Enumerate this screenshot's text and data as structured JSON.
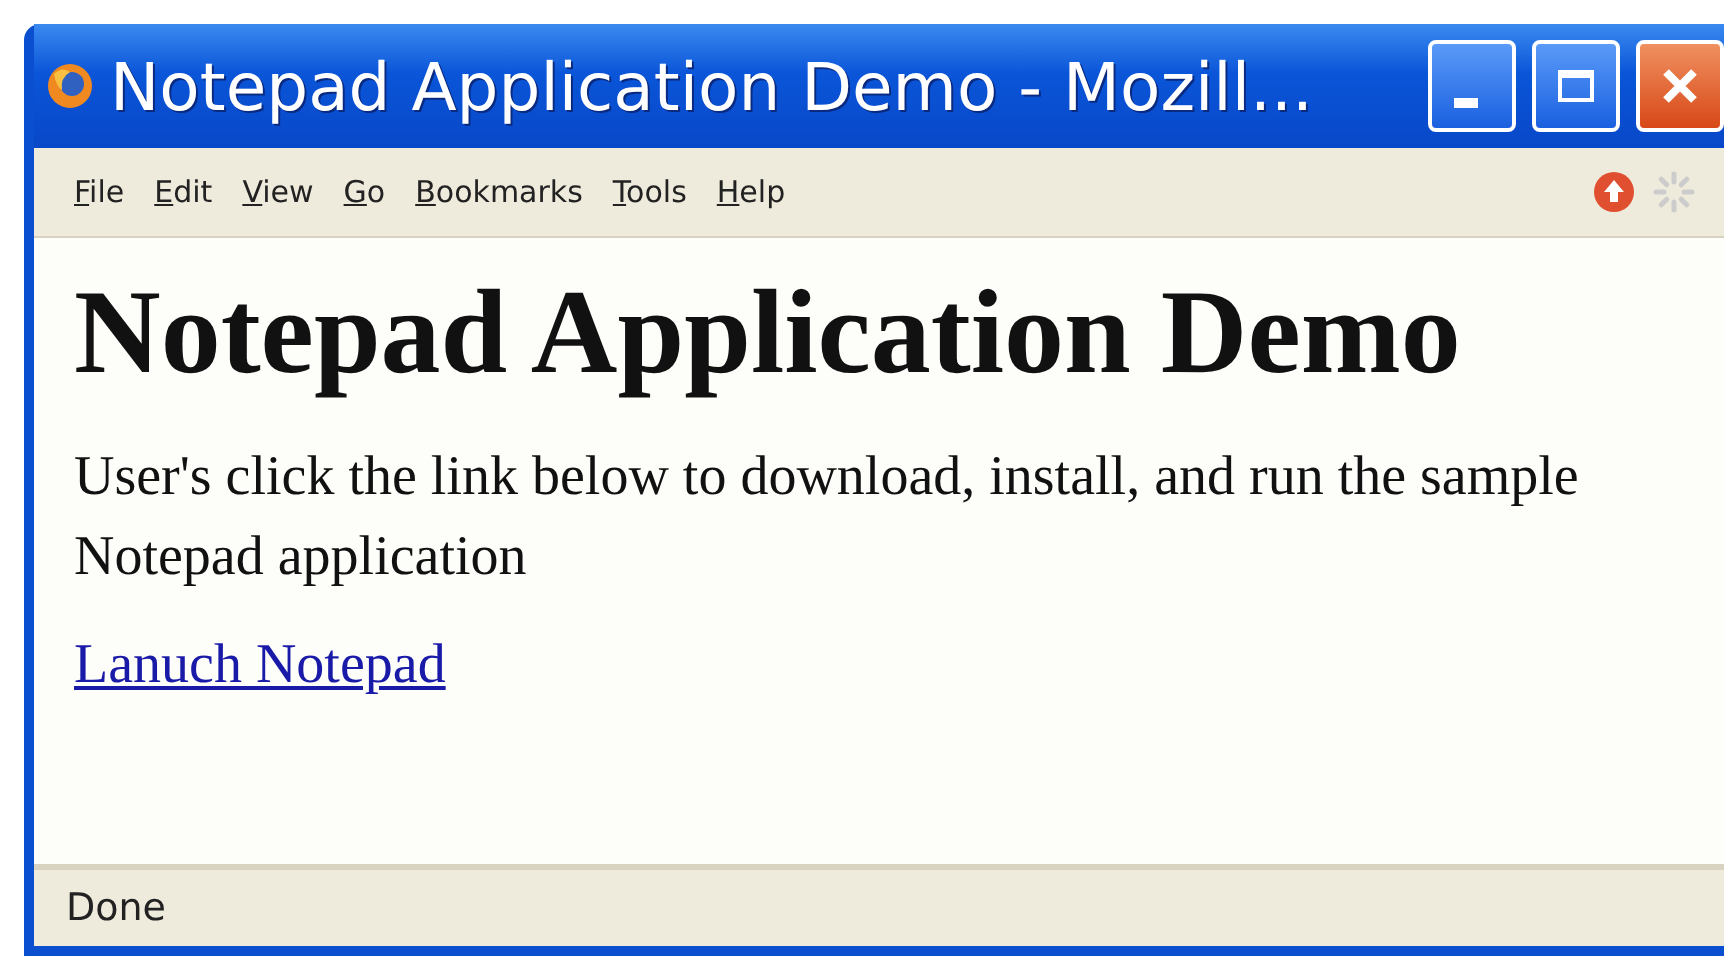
{
  "window": {
    "title": "Notepad Application Demo - Mozill..."
  },
  "menu": [
    "File",
    "Edit",
    "View",
    "Go",
    "Bookmarks",
    "Tools",
    "Help"
  ],
  "page": {
    "heading": "Notepad Application Demo",
    "paragraph": "User's click the link below to download, install, and run the sample Notepad application",
    "link": "Lanuch Notepad"
  },
  "status_bar": "Done"
}
